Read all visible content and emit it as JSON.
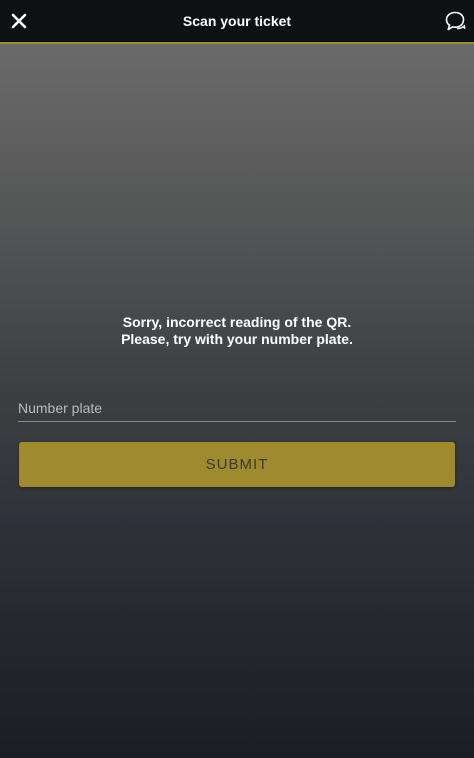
{
  "header": {
    "title": "Scan your ticket",
    "close_icon": "close-icon",
    "chat_icon": "chat-icon"
  },
  "message": {
    "line1": "Sorry, incorrect reading of the QR.",
    "line2": "Please, try with your number plate."
  },
  "form": {
    "number_plate_value": "",
    "number_plate_placeholder": "Number plate",
    "submit_label": "SUBMIT"
  },
  "colors": {
    "accent": "#a08a2e",
    "header_bg": "#0e1114",
    "header_border": "#9a8a2e"
  }
}
